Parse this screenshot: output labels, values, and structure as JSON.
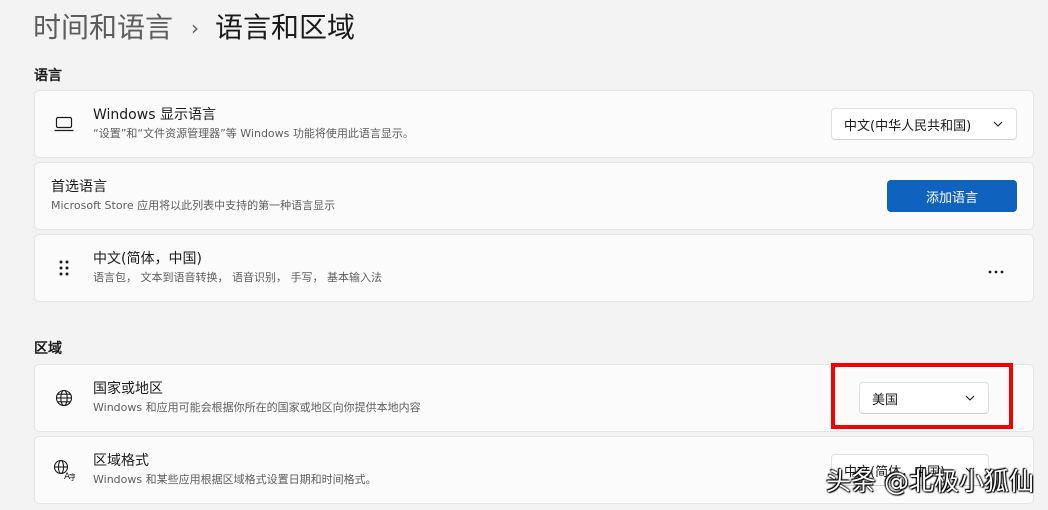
{
  "breadcrumb": {
    "parent": "时间和语言",
    "separator": "›",
    "current": "语言和区域"
  },
  "language_section": {
    "label": "语言",
    "display_language": {
      "icon": "laptop-icon",
      "title": "Windows 显示语言",
      "description": "“设置”和“文件资源管理器”等 Windows 功能将使用此语言显示。",
      "selected": "中文(中华人民共和国)"
    },
    "preferred": {
      "title": "首选语言",
      "description": "Microsoft Store 应用将以此列表中支持的第一种语言显示",
      "button_label": "添加语言"
    },
    "language_item": {
      "icon": "drag-handle-icon",
      "title": "中文(简体，中国)",
      "description": "语言包， 文本到语音转换， 语音识别， 手写， 基本输入法",
      "more_icon": "more-icon"
    }
  },
  "region_section": {
    "label": "区域",
    "country": {
      "icon": "globe-icon",
      "title": "国家或地区",
      "description": "Windows 和应用可能会根据你所在的国家或地区向你提供本地内容",
      "selected": "美国"
    },
    "format": {
      "icon": "regional-format-icon",
      "title": "区域格式",
      "description": "Windows 和某些应用根据区域格式设置日期和时间格式。",
      "selected": "中文(简体，中国)"
    }
  },
  "watermark": "头条 @北极小狐仙",
  "colors": {
    "accent": "#0f62bd",
    "highlight": "#f20000",
    "background": "#f3f3f3",
    "card": "#fbfbfb"
  }
}
